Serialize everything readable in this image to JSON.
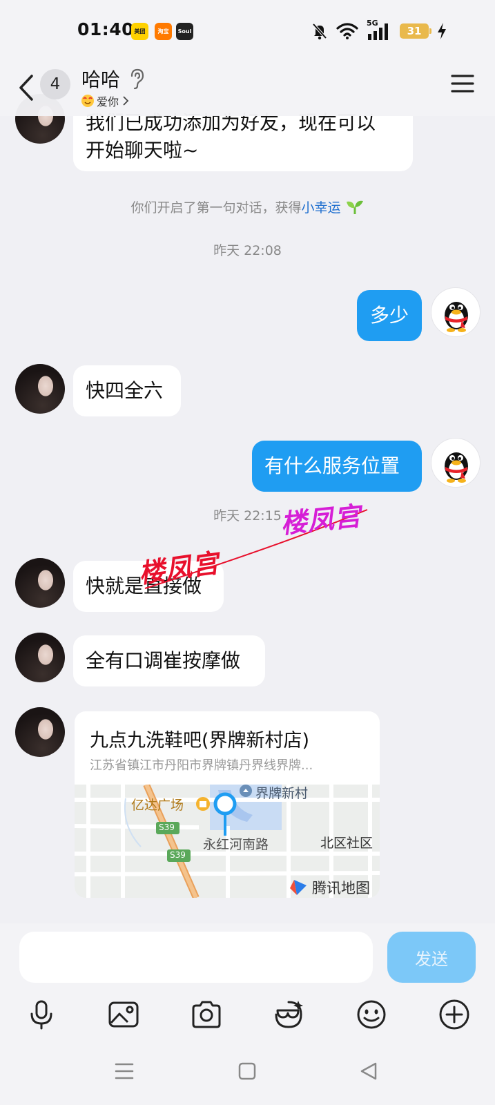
{
  "status_bar": {
    "time": "01:40",
    "apps": [
      "美团",
      "淘宝",
      "Soul"
    ],
    "network": "5G",
    "battery": "31"
  },
  "header": {
    "unread_count": "4",
    "contact_name": "哈哈",
    "status_text": "爱你"
  },
  "messages": [
    {
      "from": "them",
      "text_line1": "我们已成功添加为好友，现在可以",
      "text_line2": "开始聊天啦~"
    },
    {
      "system": "你们开启了第一句对话，获得",
      "system_link": "小幸运"
    },
    {
      "timestamp": "昨天 22:08"
    },
    {
      "from": "me",
      "text": "多少"
    },
    {
      "from": "them",
      "text": "快四全六"
    },
    {
      "from": "me",
      "text": "有什么服务位置"
    },
    {
      "timestamp": "昨天 22:15"
    },
    {
      "from": "them",
      "text": "快就是直接做"
    },
    {
      "from": "them",
      "text": "全有口调崔按摩做"
    }
  ],
  "location_card": {
    "title": "九点九洗鞋吧(界牌新村店)",
    "address": "江苏省镇江市丹阳市界牌镇丹界线界牌...",
    "map_labels": {
      "poi_1": "亿达广场",
      "poi_2": "界牌新村",
      "road": "永红河南路",
      "area": "北区社区",
      "highway": "S39",
      "provider": "腾讯地图"
    }
  },
  "watermark": "楼凤宫",
  "input": {
    "placeholder": "",
    "send_label": "发送"
  },
  "colors": {
    "outgoing_bubble": "#1f9df2",
    "send_button": "#7cc8f8",
    "link": "#1f6fcf",
    "watermark_red": "#e8102c",
    "watermark_magenta": "#d61ed6"
  }
}
